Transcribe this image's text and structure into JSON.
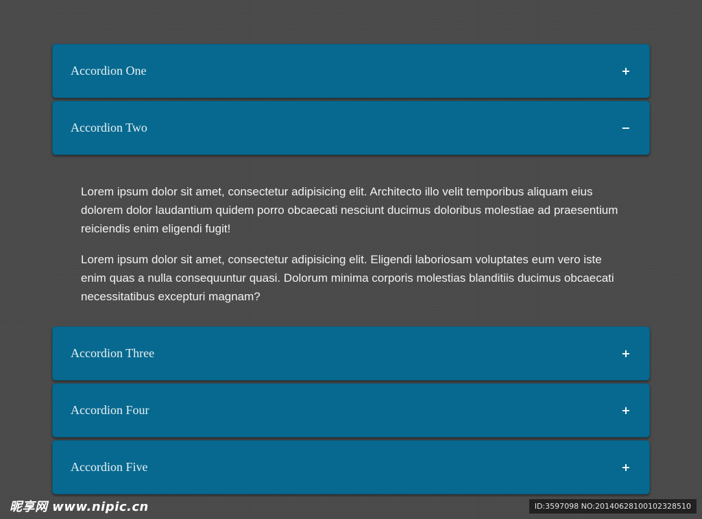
{
  "accordion": {
    "items": [
      {
        "title": "Accordion One",
        "toggle": "+"
      },
      {
        "title": "Accordion Two",
        "toggle": "−"
      },
      {
        "title": "Accordion Three",
        "toggle": "+"
      },
      {
        "title": "Accordion Four",
        "toggle": "+"
      },
      {
        "title": "Accordion Five",
        "toggle": "+"
      }
    ],
    "expanded_content": {
      "paragraphs": [
        "Lorem ipsum dolor sit amet, consectetur adipisicing elit. Architecto illo velit temporibus aliquam eius dolorem dolor laudantium quidem porro obcaecati nesciunt ducimus doloribus molestiae ad praesentium reiciendis enim eligendi fugit!",
        "Lorem ipsum dolor sit amet, consectetur adipisicing elit. Eligendi laboriosam voluptates eum vero iste enim quas a nulla consequuntur quasi. Dolorum minima corporis molestias blanditiis ducimus obcaecati necessitatibus excepturi magnam?"
      ]
    }
  },
  "watermark": {
    "left_text": "昵享网 www.nipic.cn",
    "right_text": "ID:3597098 NO:20140628100102328510"
  },
  "colors": {
    "background": "#4a4a4a",
    "header": "#07698f",
    "header_text": "#e8f1f5",
    "content_text": "#f2f2f2"
  }
}
